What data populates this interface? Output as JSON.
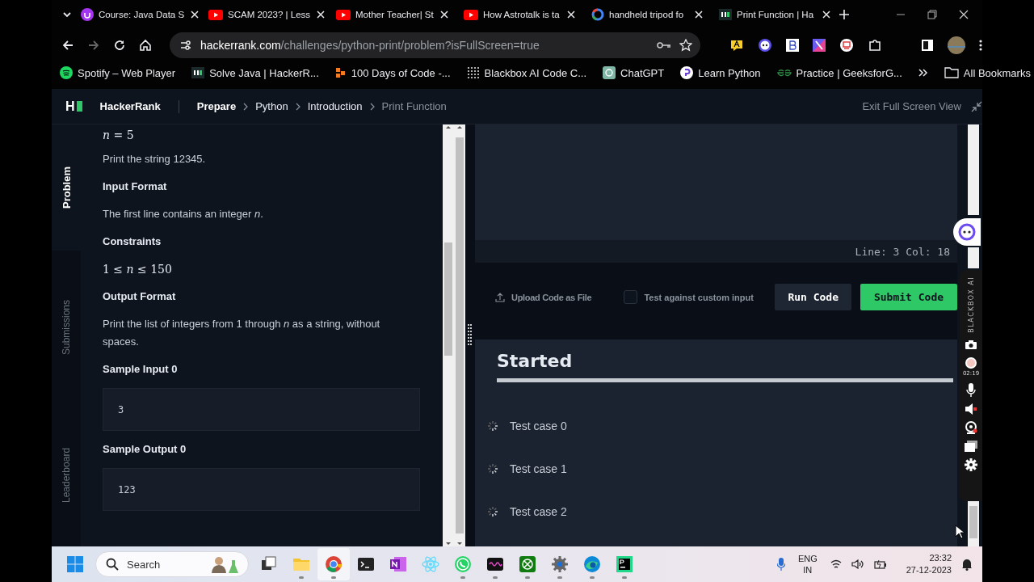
{
  "browser": {
    "tabs": [
      {
        "title": "Course: Java Data S",
        "kind": "udemy"
      },
      {
        "title": "SCAM 2023? | Less",
        "kind": "youtube"
      },
      {
        "title": "Mother Teacher| St",
        "kind": "youtube"
      },
      {
        "title": "How Astrotalk is ta",
        "kind": "youtube"
      },
      {
        "title": "handheld tripod fo",
        "kind": "google"
      },
      {
        "title": "Print Function | Ha",
        "kind": "hackerrank"
      }
    ],
    "url_host": "hackerrank.com",
    "url_path": "/challenges/python-print/problem?isFullScreen=true",
    "bookmarks": [
      {
        "label": "Spotify – Web Player",
        "kind": "spotify"
      },
      {
        "label": "Solve Java | HackerR...",
        "kind": "hackerrank"
      },
      {
        "label": "100 Days of Code -...",
        "kind": "days"
      },
      {
        "label": "Blackbox AI Code C...",
        "kind": "blackbox"
      },
      {
        "label": "ChatGPT",
        "kind": "chatgpt"
      },
      {
        "label": "Learn Python",
        "kind": "learnpython"
      },
      {
        "label": "Practice | GeeksforG...",
        "kind": "gfg"
      }
    ],
    "all_bookmarks": "All Bookmarks"
  },
  "header": {
    "logo": "H",
    "brand": "HackerRank",
    "breadcrumbs": [
      {
        "label": "Prepare",
        "current": false,
        "bold": true
      },
      {
        "label": "Python",
        "current": false,
        "bold": false
      },
      {
        "label": "Introduction",
        "current": false,
        "bold": false
      },
      {
        "label": "Print Function",
        "current": true,
        "bold": false
      }
    ],
    "exit": "Exit Full Screen View"
  },
  "side_tabs": [
    {
      "label": "Problem",
      "selected": true
    },
    {
      "label": "Submissions",
      "selected": false
    },
    {
      "label": "Leaderboard",
      "selected": false
    }
  ],
  "problem": [
    {
      "kind": "math",
      "text": "*n* = 5"
    },
    {
      "kind": "para",
      "text": "Print the string 12345."
    },
    {
      "kind": "heading",
      "text": "Input Format"
    },
    {
      "kind": "para",
      "text": "The first line contains an integer *n*."
    },
    {
      "kind": "heading",
      "text": "Constraints"
    },
    {
      "kind": "math",
      "text": "1 ≤ *n* ≤ 150"
    },
    {
      "kind": "heading",
      "text": "Output Format"
    },
    {
      "kind": "para",
      "text": "Print the list of integers from 1 through *n* as a string, without spaces."
    },
    {
      "kind": "heading",
      "text": "Sample Input 0"
    },
    {
      "kind": "code",
      "text": "3"
    },
    {
      "kind": "heading",
      "text": "Sample Output 0"
    },
    {
      "kind": "code",
      "text": "123"
    }
  ],
  "editor": {
    "status": "Line: 3 Col: 18",
    "upload": "Upload Code as File",
    "custom_input": {
      "label": "Test against custom input",
      "checked": false
    },
    "buttons": [
      {
        "label": "Run Code",
        "kind": "secondary"
      },
      {
        "label": "Submit Code",
        "kind": "primary"
      }
    ]
  },
  "results": {
    "title": "Started",
    "test_cases": [
      "Test case 0",
      "Test case 1",
      "Test case 2"
    ]
  },
  "recorder": {
    "label": "BLACKBOX AI",
    "timer": "02:19"
  },
  "taskbar": {
    "search": "Search",
    "apps": [
      {
        "kind": "taskview",
        "running": false
      },
      {
        "kind": "explorer",
        "running": true
      },
      {
        "kind": "chrome",
        "running": true
      },
      {
        "kind": "terminal",
        "running": false
      },
      {
        "kind": "onenote",
        "running": false
      },
      {
        "kind": "react",
        "running": false
      },
      {
        "kind": "whatsapp",
        "running": true
      },
      {
        "kind": "audio",
        "running": true
      },
      {
        "kind": "xbox",
        "running": true
      },
      {
        "kind": "settings",
        "running": true
      },
      {
        "kind": "edge",
        "running": true
      },
      {
        "kind": "pycharm",
        "running": true
      }
    ],
    "lang": "ENG",
    "region": "IN",
    "time": "23:32",
    "date": "27-12-2023"
  }
}
